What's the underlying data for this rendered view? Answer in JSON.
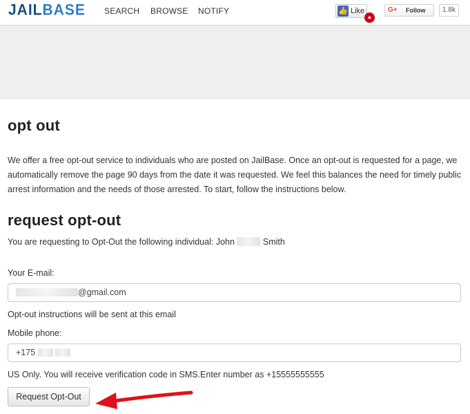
{
  "header": {
    "logo_jail": "JAIL",
    "logo_base": "BASE",
    "nav": [
      "SEARCH",
      "BROWSE",
      "NOTIFY"
    ],
    "like_label": "Like",
    "follow_label": "Follow",
    "follow_count": "1.8k"
  },
  "main": {
    "title": "opt out",
    "intro": "We offer a free opt-out service to individuals who are posted on JailBase. Once an opt-out is requested for a page, we automatically remove the page 90 days from the date it was requested. We feel this balances the need for timely public arrest information and the needs of those arrested. To start, follow the instructions below.",
    "section_title": "request opt-out",
    "requesting_text": "You are requesting to Opt-Out the following individual:",
    "first_name": "John",
    "last_name": "Smith",
    "email_label": "Your E-mail:",
    "email_value_suffix": "@gmail.com",
    "email_note": "Opt-out instructions will be sent at this email",
    "phone_label": "Mobile phone:",
    "phone_value_prefix": "+175",
    "phone_note": "US Only. You will receive verification code in SMS.Enter number as +15555555555",
    "submit_label": "Request Opt-Out"
  },
  "colors": {
    "logo_dark": "#1a4f7a",
    "logo_light": "#2c7fc4",
    "annotation_arrow": "#e0101a"
  }
}
